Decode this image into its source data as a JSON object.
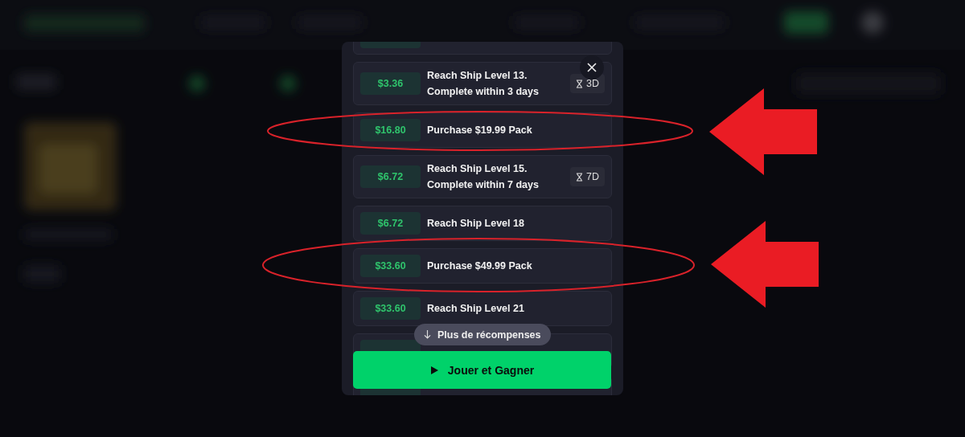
{
  "modal": {
    "rows": [
      {},
      {
        "reward": "$3.36",
        "task": "Reach Ship Level 13.",
        "detail": "Complete within 3 days",
        "timer": "3D"
      },
      {
        "reward": "$16.80",
        "task": "Purchase $19.99 Pack"
      },
      {
        "reward": "$6.72",
        "task": "Reach Ship Level 15.",
        "detail": "Complete within 7 days",
        "timer": "7D"
      },
      {
        "reward": "$6.72",
        "task": "Reach Ship Level 18"
      },
      {
        "reward": "$33.60",
        "task": "Purchase $49.99 Pack"
      },
      {
        "reward": "$33.60",
        "task": "Reach Ship Level 21"
      },
      {},
      {}
    ],
    "more_button": "Plus de récompenses",
    "play_button": "Jouer et Gagner"
  }
}
